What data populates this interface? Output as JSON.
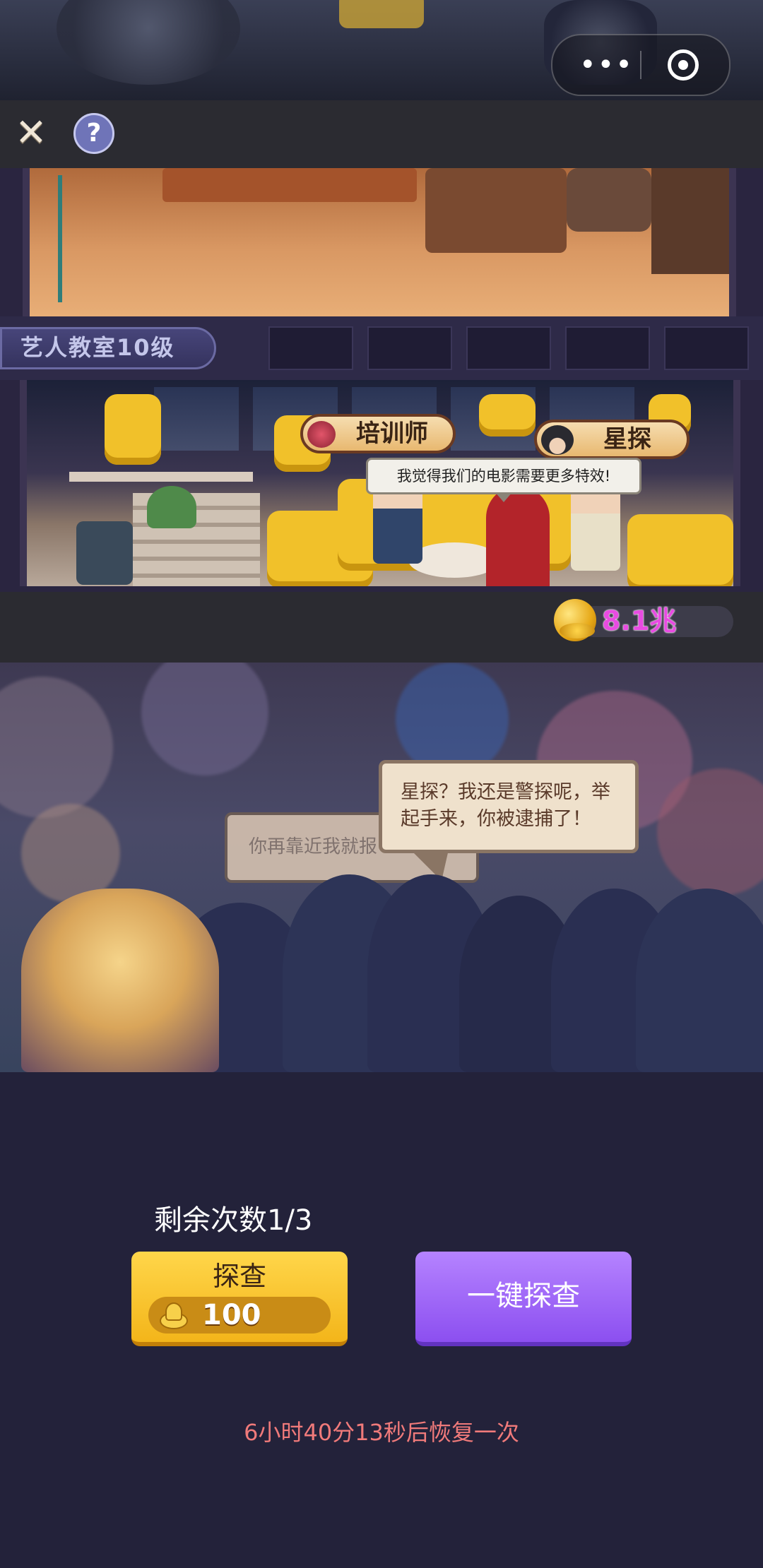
{
  "toolbar": {
    "close_label": "✕",
    "help_label": "?"
  },
  "building": {
    "level_label": "艺人教室10级",
    "roles": [
      {
        "label": "培训师"
      },
      {
        "label": "星探"
      }
    ],
    "dialog": "我觉得我们的电影需要更多特效!"
  },
  "currency": {
    "amount": "8.1兆"
  },
  "scene": {
    "speech_back": "你再靠近我就报",
    "speech_front": "星探？我还是警探呢，举起手来，你被逮捕了！"
  },
  "panel": {
    "remaining_label": "剩余次数1/3",
    "probe_button": {
      "label": "探查",
      "cost": "100"
    },
    "oneclick_button": {
      "label": "一键探查"
    },
    "timer": "6小时40分13秒后恢复一次"
  },
  "colors": {
    "accent_yellow": "#f3b51a",
    "accent_purple": "#8c4ff0",
    "currency_text": "#e94be2",
    "timer_text": "#f07a7a"
  },
  "icons": [
    "more-dots-icon",
    "target-icon",
    "close-icon",
    "help-icon",
    "dumbbell-icon",
    "detective-hat-icon",
    "coin-stack-icon",
    "gold-ingot-icon"
  ]
}
